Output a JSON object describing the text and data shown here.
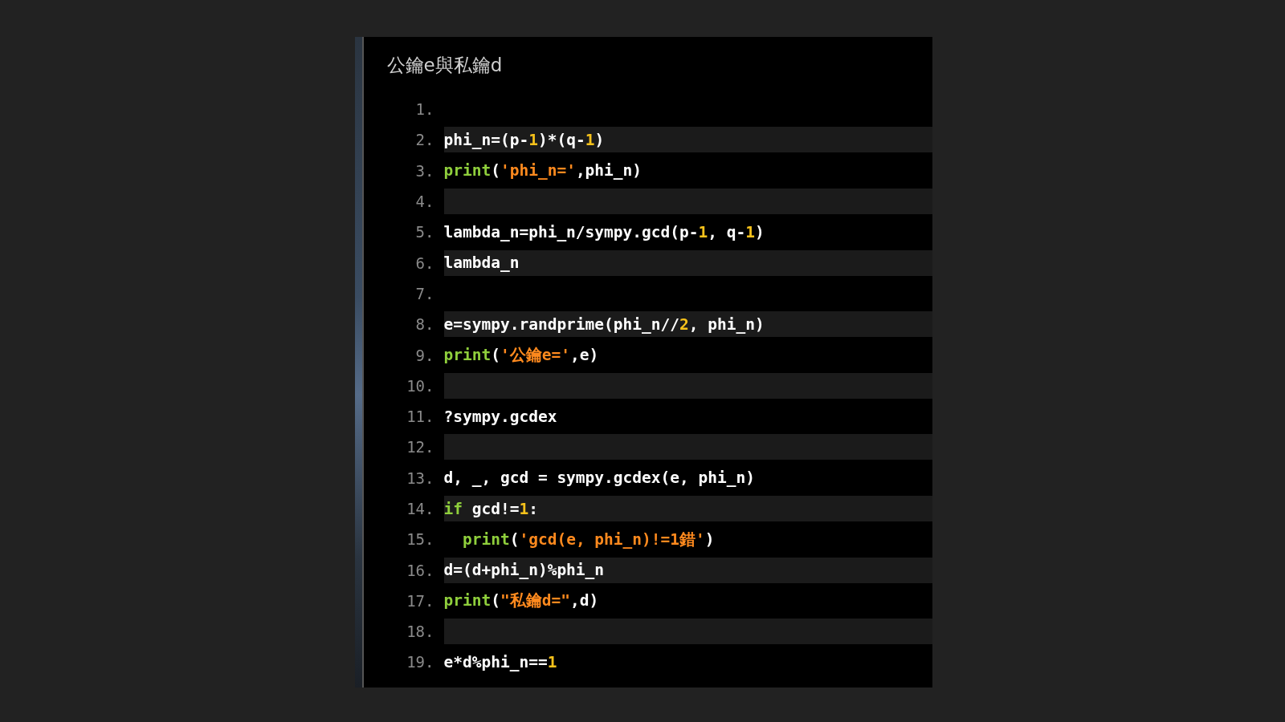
{
  "title": "公鑰e與私鑰d",
  "lines": [
    {
      "number": "1."
    },
    {
      "number": "2.",
      "tokens": [
        {
          "kind": "plain",
          "text": "phi_n=(p-"
        },
        {
          "kind": "number",
          "text": "1"
        },
        {
          "kind": "plain",
          "text": ")*(q-"
        },
        {
          "kind": "number",
          "text": "1"
        },
        {
          "kind": "plain",
          "text": ")"
        }
      ]
    },
    {
      "number": "3.",
      "tokens": [
        {
          "kind": "builtin",
          "text": "print"
        },
        {
          "kind": "plain",
          "text": "("
        },
        {
          "kind": "string",
          "text": "'phi_n='"
        },
        {
          "kind": "plain",
          "text": ",phi_n)"
        }
      ]
    },
    {
      "number": "4."
    },
    {
      "number": "5.",
      "tokens": [
        {
          "kind": "plain",
          "text": "lambda_n=phi_n/sympy.gcd(p-"
        },
        {
          "kind": "number",
          "text": "1"
        },
        {
          "kind": "plain",
          "text": ", q-"
        },
        {
          "kind": "number",
          "text": "1"
        },
        {
          "kind": "plain",
          "text": ")"
        }
      ]
    },
    {
      "number": "6.",
      "tokens": [
        {
          "kind": "plain",
          "text": "lambda_n"
        }
      ]
    },
    {
      "number": "7."
    },
    {
      "number": "8.",
      "tokens": [
        {
          "kind": "plain",
          "text": "e=sympy.randprime(phi_n//"
        },
        {
          "kind": "number",
          "text": "2"
        },
        {
          "kind": "plain",
          "text": ", phi_n)"
        }
      ]
    },
    {
      "number": "9.",
      "tokens": [
        {
          "kind": "builtin",
          "text": "print"
        },
        {
          "kind": "plain",
          "text": "("
        },
        {
          "kind": "string",
          "text": "'公鑰e='"
        },
        {
          "kind": "plain",
          "text": ",e)"
        }
      ]
    },
    {
      "number": "10."
    },
    {
      "number": "11.",
      "tokens": [
        {
          "kind": "plain",
          "text": "?sympy.gcdex"
        }
      ]
    },
    {
      "number": "12."
    },
    {
      "number": "13.",
      "tokens": [
        {
          "kind": "plain",
          "text": "d, _, gcd = sympy.gcdex(e, phi_n)"
        }
      ]
    },
    {
      "number": "14.",
      "tokens": [
        {
          "kind": "keyword",
          "text": "if"
        },
        {
          "kind": "plain",
          "text": " gcd!="
        },
        {
          "kind": "number",
          "text": "1"
        },
        {
          "kind": "plain",
          "text": ":"
        }
      ]
    },
    {
      "number": "15.",
      "tokens": [
        {
          "kind": "builtin",
          "text": "  print"
        },
        {
          "kind": "plain",
          "text": "("
        },
        {
          "kind": "string",
          "text": "'gcd(e, phi_n)!=1錯'"
        },
        {
          "kind": "plain",
          "text": ")"
        }
      ]
    },
    {
      "number": "16.",
      "tokens": [
        {
          "kind": "plain",
          "text": "d=(d+phi_n)%phi_n"
        }
      ]
    },
    {
      "number": "17.",
      "tokens": [
        {
          "kind": "builtin",
          "text": "print"
        },
        {
          "kind": "plain",
          "text": "("
        },
        {
          "kind": "string",
          "text": "\"私鑰d=\""
        },
        {
          "kind": "plain",
          "text": ",d)"
        }
      ]
    },
    {
      "number": "18."
    },
    {
      "number": "19.",
      "tokens": [
        {
          "kind": "plain",
          "text": "e*d%phi_n=="
        },
        {
          "kind": "number",
          "text": "1"
        }
      ]
    }
  ]
}
